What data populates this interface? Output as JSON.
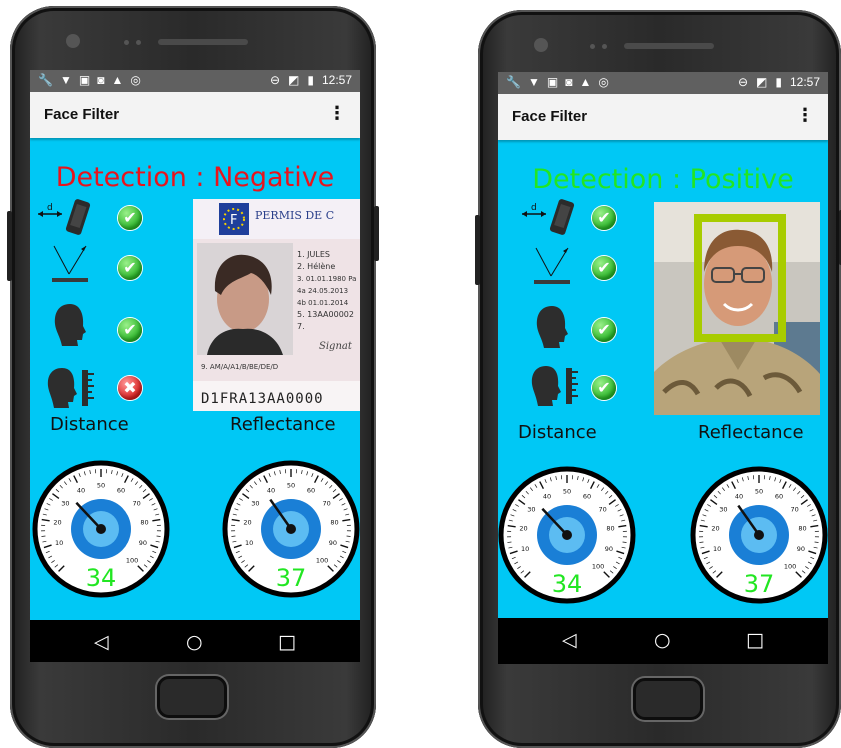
{
  "phones": [
    {
      "status": {
        "time": "12:57"
      },
      "app_title": "Face Filter",
      "detection": {
        "text": "Detection : Negative",
        "color": "#e8141c"
      },
      "checks": [
        "ok",
        "ok",
        "ok",
        "bad"
      ],
      "card": {
        "header": "PERMIS DE C",
        "lines": [
          "1. JULES",
          "2. Hélène",
          "3. 01.01.1980 Pa",
          "4a 24.05.2013",
          "4b 01.01.2014",
          "5. 13AA00002",
          "7."
        ],
        "categories": "9. AM/A/A1/B/BE/DE/D",
        "mrz": "D1FRA13AA0000",
        "flag_letter": "F",
        "signature": "Signat"
      },
      "labels": {
        "distance": "Distance",
        "reflectance": "Reflectance"
      },
      "gauges": [
        {
          "value": 34
        },
        {
          "value": 37
        }
      ]
    },
    {
      "status": {
        "time": "12:57"
      },
      "app_title": "Face Filter",
      "detection": {
        "text": "Detection : Positive",
        "color": "#22e622"
      },
      "checks": [
        "ok",
        "ok",
        "ok",
        "ok"
      ],
      "labels": {
        "distance": "Distance",
        "reflectance": "Reflectance"
      },
      "gauges": [
        {
          "value": 34
        },
        {
          "value": 37
        }
      ]
    }
  ],
  "gauge_ticks": [
    "10",
    "20",
    "30",
    "40",
    "50",
    "60",
    "70",
    "80",
    "90",
    "100"
  ],
  "gauge_value_color": "#22e622",
  "icons": {
    "menu": "overflow-menu-icon",
    "nav": [
      "back-icon",
      "home-icon",
      "recents-icon"
    ]
  }
}
